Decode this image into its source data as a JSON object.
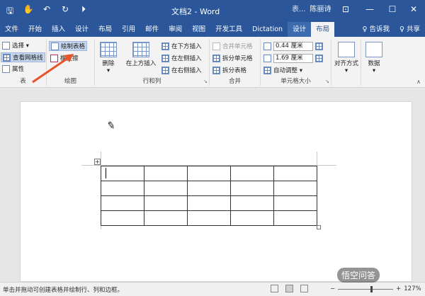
{
  "titlebar": {
    "doc_title": "文档2 - Word",
    "table_tools": "表...",
    "user_name": "陈丽诗",
    "qat": {
      "save": "🖫",
      "touch": "✋",
      "undo": "↶",
      "redo": "↻",
      "more": "⏵"
    },
    "win": {
      "restore_ribbon": "⊡",
      "minimize": "—",
      "maximize": "☐",
      "close": "✕"
    }
  },
  "tabs": [
    "文件",
    "开始",
    "插入",
    "设计",
    "布局",
    "引用",
    "邮件",
    "审阅",
    "视图",
    "开发工具",
    "Dictation",
    "设计",
    "布局"
  ],
  "tabs_right": {
    "tell_me": "♀ 告诉我",
    "share": "♀ 共享"
  },
  "ribbon": {
    "table_group": {
      "select": "选择 ▾",
      "view_gridlines": "查看网格线",
      "properties": "属性",
      "label": "表"
    },
    "draw_group": {
      "draw_table": "绘制表格",
      "eraser": "橡皮擦",
      "label": "绘图"
    },
    "rows_cols_group": {
      "delete": "删除",
      "insert_above": "在上方插入",
      "insert_below": "在下方插入",
      "insert_left": "在左侧插入",
      "insert_right": "在右侧插入",
      "label": "行和列"
    },
    "merge_group": {
      "merge_cells": "合并单元格",
      "split_cells": "拆分单元格",
      "split_table": "拆分表格",
      "label": "合并"
    },
    "cell_size_group": {
      "height": "0.44 厘米",
      "width": "1.69 厘米",
      "autofit": "自动调整 ▾",
      "label": "单元格大小"
    },
    "alignment": {
      "label": "对齐方式"
    },
    "data": {
      "label": "数据"
    }
  },
  "table": {
    "rows": 4,
    "cols": 5
  },
  "statusbar": {
    "message": "单击并拖动可创建表格并绘制行、列和边框。",
    "zoom": "127%"
  },
  "watermark": "悟空问答",
  "colors": {
    "accent": "#2b579a",
    "arrow": "#e8532b"
  }
}
